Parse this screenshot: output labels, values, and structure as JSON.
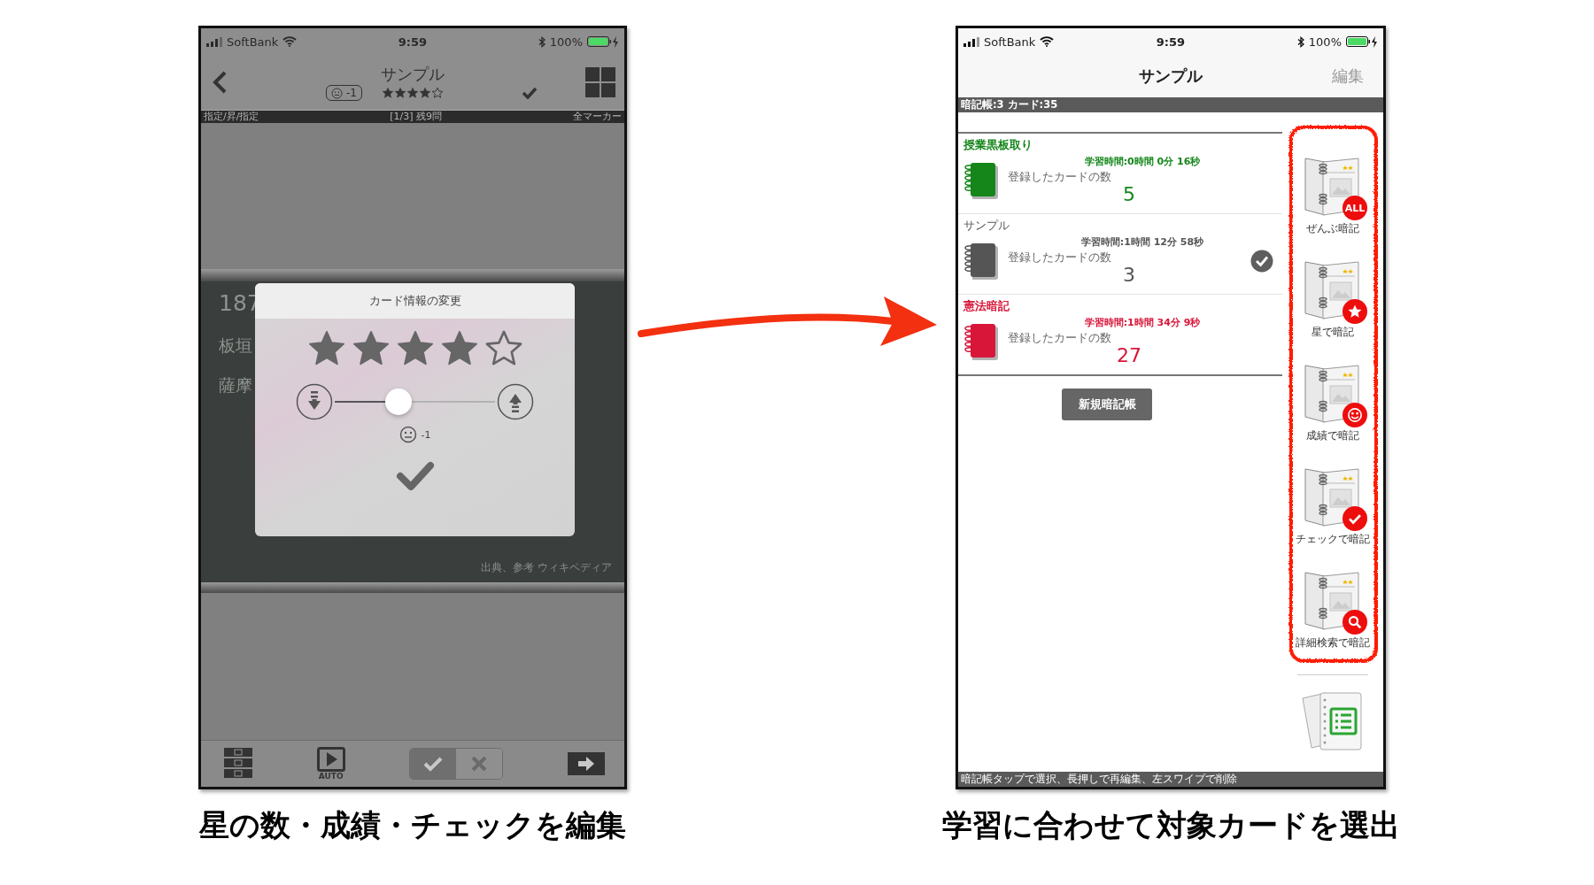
{
  "left_screen": {
    "status_bar": {
      "carrier": "SoftBank",
      "time": "9:59",
      "battery": "100%"
    },
    "nav": {
      "title": "サンプル",
      "grade": "-1",
      "stars": 4,
      "checked": true
    },
    "info_bar": {
      "left": "指定/昇/指定",
      "center": "[1/3] 残9問",
      "right": "全マーカー"
    },
    "card_texts": [
      "187",
      "板垣",
      "薩摩"
    ],
    "source": "出典、参考 ウィキペディア",
    "dialog": {
      "title": "カード情報の変更",
      "stars": 4,
      "level": 0.4,
      "grade": "-1"
    },
    "toolbar": {
      "auto_label": "AUTO",
      "toggle": [
        {
          "kind": "check",
          "selected": true
        },
        {
          "kind": "cross",
          "selected": false
        }
      ]
    }
  },
  "right_screen": {
    "status_bar": {
      "carrier": "SoftBank",
      "time": "9:59",
      "battery": "100%"
    },
    "nav": {
      "title": "サンプル",
      "edit": "編集"
    },
    "summary": "暗記帳:3 カード:35",
    "notebooks": [
      {
        "name": "授業黒板取り",
        "study_time": "学習時間:0時間 0分 16秒",
        "count_label": "登録したカードの数",
        "count": "5",
        "color": "#14861a",
        "selected": false
      },
      {
        "name": "サンプル",
        "study_time": "学習時間:1時間 12分 58秒",
        "count_label": "登録したカードの数",
        "count": "3",
        "color": "#555555",
        "selected": true
      },
      {
        "name": "憲法暗記",
        "study_time": "学習時間:1時間 34分 9秒",
        "count_label": "登録したカードの数",
        "count": "27",
        "color": "#d8163a",
        "selected": false
      }
    ],
    "new_button": "新規暗記帳",
    "modes": [
      {
        "kind": "all",
        "label": "ぜんぶ暗記",
        "badge_text": "ALL"
      },
      {
        "kind": "star",
        "label": "星で暗記"
      },
      {
        "kind": "grade",
        "label": "成績で暗記"
      },
      {
        "kind": "check",
        "label": "チェックで暗記"
      },
      {
        "kind": "search",
        "label": "詳細検索で暗記"
      }
    ],
    "hint": "暗記帳タップで選択、長押しで再編集、左スワイプで削除"
  },
  "captions": [
    "星の数・成績・チェックを編集",
    "学習に合わせて対象カードを選出"
  ]
}
